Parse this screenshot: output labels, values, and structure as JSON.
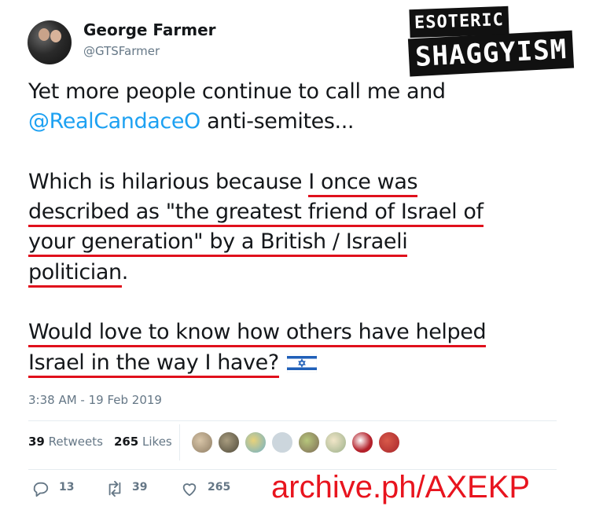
{
  "tweet": {
    "author_name": "George Farmer",
    "author_handle": "@GTSFarmer",
    "body": {
      "l1": "Yet more people continue to call me and",
      "l2_mention": "@RealCandaceO",
      "l2_rest": " anti-semites...",
      "l3a": "Which is hilarious because ",
      "l3b": "I once was",
      "l4": "described as \"the greatest friend of Israel of",
      "l5": "your generation\" by a British / Israeli",
      "l6": "politician",
      "l6_end": ".",
      "l7": "Would love to know how others have helped",
      "l8": "Israel in the way I have?"
    },
    "timestamp": "3:38 AM - 19 Feb 2019",
    "retweets_count": "39",
    "retweets_label": "Retweets",
    "likes_count": "265",
    "likes_label": "Likes",
    "actions": {
      "reply_count": "13",
      "retweet_count": "39",
      "like_count": "265"
    }
  },
  "overlay": {
    "stamp_top": "ESOTERIC",
    "stamp_bottom": "SHAGGYISM",
    "watermark": "archive.ph/AXEKP"
  },
  "colors": {
    "underline": "#e0101c",
    "mention": "#1da1f2",
    "watermark": "#e8141e"
  }
}
